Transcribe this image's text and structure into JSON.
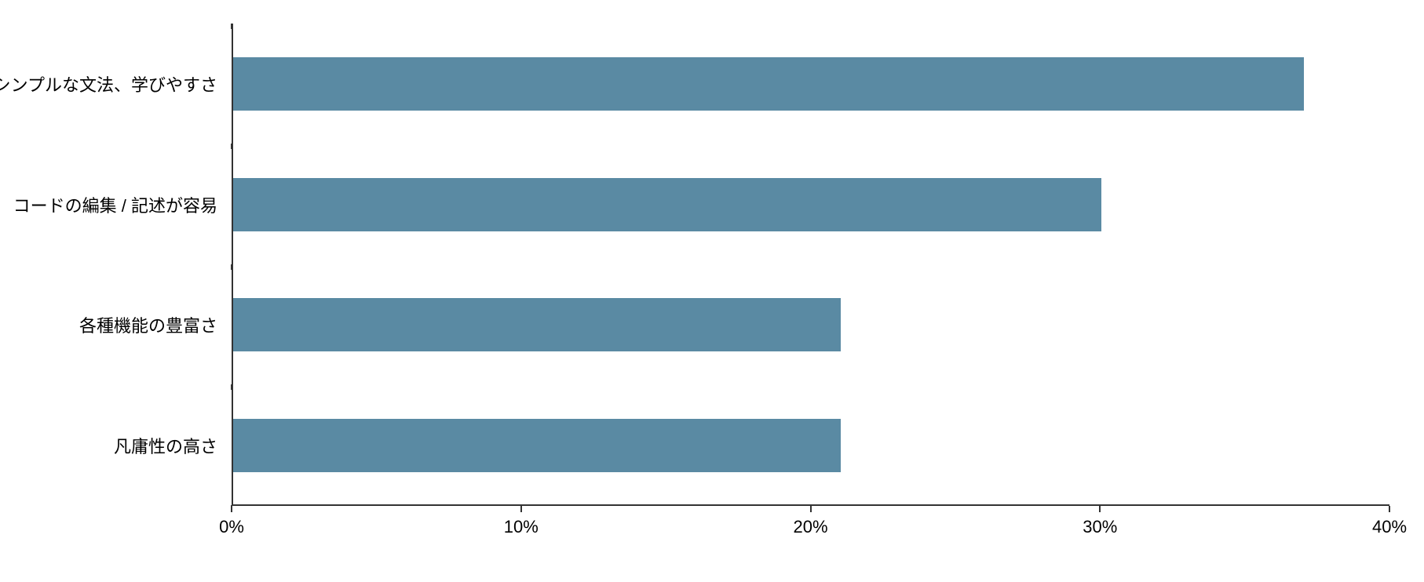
{
  "chart_data": {
    "type": "bar",
    "orientation": "horizontal",
    "categories": [
      "シンプルな文法、学びやすさ",
      "コードの編集 / 記述が容易",
      "各種機能の豊富さ",
      "凡庸性の高さ"
    ],
    "values": [
      37,
      30,
      21,
      21
    ],
    "x_ticks": [
      0,
      10,
      20,
      30,
      40
    ],
    "x_tick_labels": [
      "0%",
      "10%",
      "20%",
      "30%",
      "40%"
    ],
    "xlim": [
      0,
      40
    ],
    "bar_color": "#5a8aa3",
    "title": "",
    "xlabel": "",
    "ylabel": ""
  }
}
